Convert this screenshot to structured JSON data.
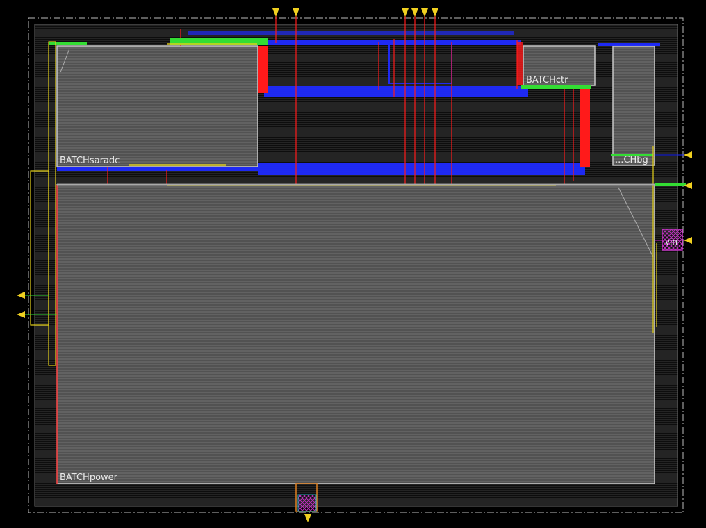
{
  "layout_view": {
    "blocks": [
      {
        "id": "saradc",
        "label": "BATCHsaradc"
      },
      {
        "id": "ctr",
        "label": "BATCHctr"
      },
      {
        "id": "bg",
        "label": "...CHbg"
      },
      {
        "id": "power",
        "label": "BATCHpower"
      }
    ],
    "pins": [
      {
        "id": "vin",
        "label": "vin"
      }
    ],
    "colors": {
      "background": "#000000",
      "die_outline": "#bdbdbd",
      "block_fill": "#5a5a5a",
      "block_outline": "#c8c8c8",
      "metal_blue": "#1f2bff",
      "metal_red": "#ff1a1a",
      "metal_green": "#33dd33",
      "metal_yellow": "#e6d21a",
      "pin_magenta": "#c030c0",
      "pin_marker": "#f0d020"
    }
  }
}
